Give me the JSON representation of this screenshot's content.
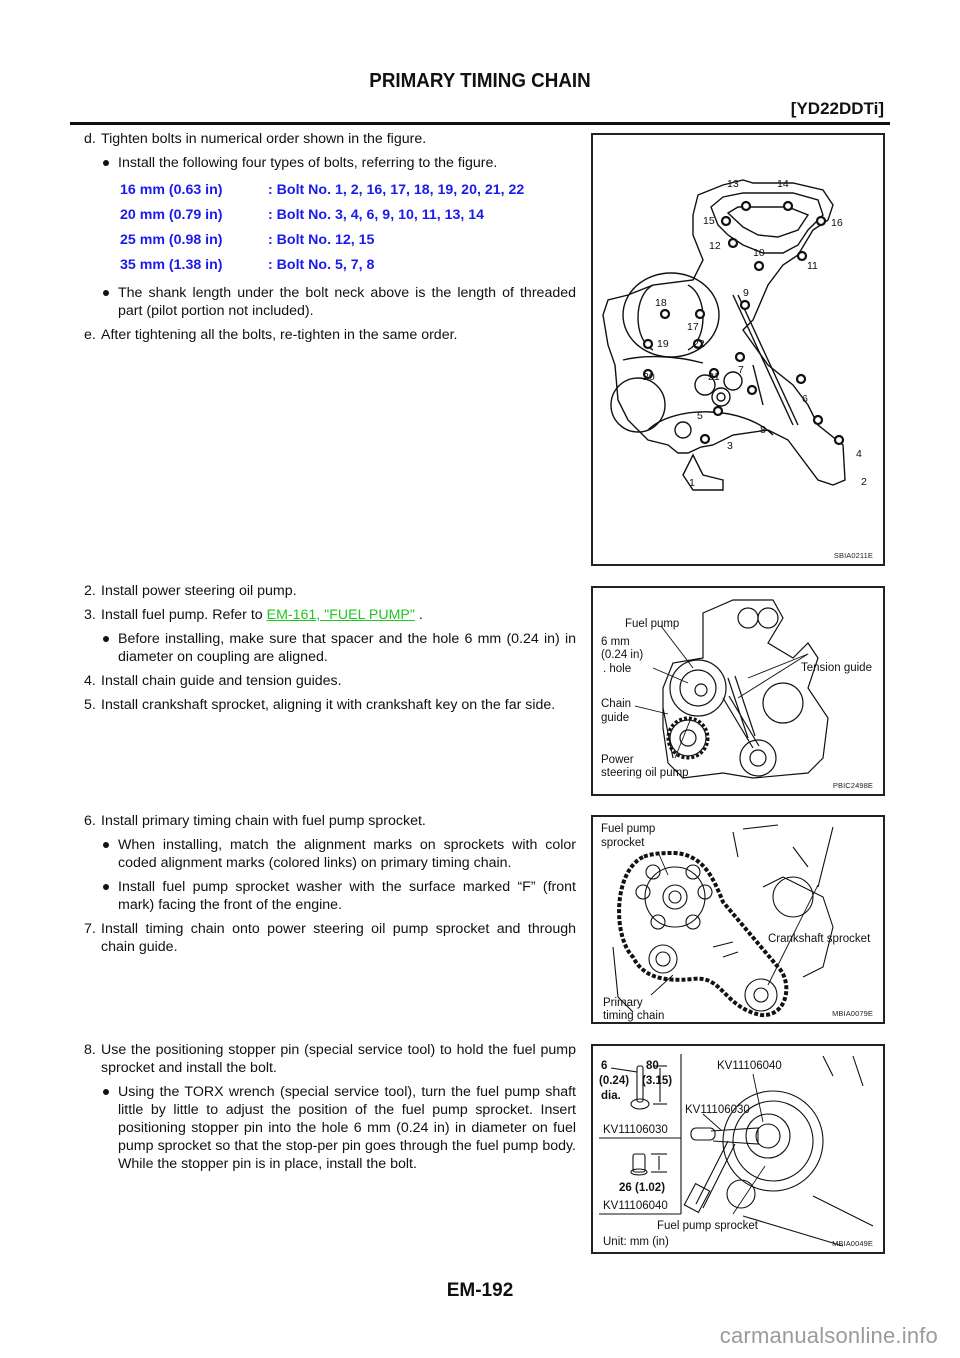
{
  "header": {
    "title": "PRIMARY TIMING CHAIN",
    "engine_code": "[YD22DDTi]"
  },
  "section1": {
    "step_d": {
      "num": "d.",
      "text": "Tighten bolts in numerical order shown in the figure."
    },
    "bullet1": "Install the following four types of bolts, referring to the figure.",
    "bolt_specs": [
      {
        "length": "16 mm (0.63 in)",
        "bolts": ": Bolt No. 1, 2, 16, 17, 18, 19, 20, 21, 22"
      },
      {
        "length": "20 mm (0.79 in)",
        "bolts": ": Bolt No. 3, 4, 6, 9, 10, 11, 13, 14"
      },
      {
        "length": "25 mm (0.98 in)",
        "bolts": ": Bolt No. 12, 15"
      },
      {
        "length": "35 mm (1.38 in)",
        "bolts": ": Bolt No. 5, 7, 8"
      }
    ],
    "bullet2": "The shank length under the bolt neck above is the length of threaded part (pilot portion not included).",
    "step_e": {
      "num": "e.",
      "text": "After tightening all the bolts, re-tighten in the same order."
    }
  },
  "section2": {
    "step2": {
      "num": "2.",
      "text": "Install power steering oil pump."
    },
    "step3": {
      "num": "3.",
      "text_before": "Install fuel pump. Refer to ",
      "link": "EM-161, \"FUEL PUMP\"",
      "text_after": " ."
    },
    "bullet": "Before installing, make sure that spacer and the hole 6 mm (0.24 in) in diameter on coupling are aligned.",
    "step4": {
      "num": "4.",
      "text": "Install chain guide and tension guides."
    },
    "step5": {
      "num": "5.",
      "text": "Install crankshaft sprocket, aligning it with crankshaft key on the far side."
    }
  },
  "section3": {
    "step6": {
      "num": "6.",
      "text": "Install primary timing chain with fuel pump sprocket."
    },
    "bullet1": "When installing, match the alignment marks on sprockets with color coded alignment marks (colored links) on primary timing chain.",
    "bullet2": "Install fuel pump sprocket washer with the surface marked “F” (front mark) facing the front of the engine.",
    "step7": {
      "num": "7.",
      "text": "Install timing chain onto power steering oil pump sprocket and through chain guide."
    }
  },
  "section4": {
    "step8": {
      "num": "8.",
      "text": "Use the positioning stopper pin (special service tool) to hold the fuel pump sprocket and install the bolt."
    },
    "bullet": "Using the TORX wrench (special service tool), turn the fuel pump shaft little by little to adjust the position of the fuel pump sprocket. Insert positioning stopper pin into the hole 6 mm (0.24 in) in diameter on fuel pump sprocket so that the stop-per pin goes through the fuel pump body. While the stopper pin is in place, install the bolt."
  },
  "figures": {
    "fig1": {
      "id": "SBIA0211E",
      "bolt_numbers": [
        "1",
        "2",
        "3",
        "4",
        "5",
        "6",
        "7",
        "8",
        "9",
        "10",
        "11",
        "12",
        "13",
        "14",
        "15",
        "16",
        "17",
        "18",
        "19",
        "20",
        "21",
        "22"
      ]
    },
    "fig2": {
      "id": "PBIC2498E",
      "labels": {
        "fuel_pump": "Fuel pump",
        "hole_1": "6 mm",
        "hole_2": "(0.24 in)",
        "hole_3": ". hole",
        "tension_guide": "Tension guide",
        "chain_guide_1": "Chain",
        "chain_guide_2": "guide",
        "ps_pump_1": "Power",
        "ps_pump_2": "steering oil pump"
      }
    },
    "fig3": {
      "id": "MBIA0079E",
      "labels": {
        "fp_sprocket_1": "Fuel pump",
        "fp_sprocket_2": "sprocket",
        "crank_sprocket": "Crankshaft sprocket",
        "chain_1": "Primary",
        "chain_2": "timing chain"
      }
    },
    "fig4": {
      "id": "MBIA0049E",
      "labels": {
        "pin_dia_1": "6",
        "pin_dia_2": "(0.24)",
        "pin_dia_3": "dia.",
        "pin_len_1": "80",
        "pin_len_2": "(3.15)",
        "tool_a": "KV11106030",
        "socket_len": "26 (1.02)",
        "tool_b": "KV11106040",
        "callout_b": "KV11106040",
        "callout_a": "KV11106030",
        "sprocket": "Fuel pump sprocket",
        "unit": "Unit: mm (in)"
      }
    }
  },
  "footer": {
    "page_number": "EM-192",
    "watermark": "carmanualsonline.info"
  }
}
